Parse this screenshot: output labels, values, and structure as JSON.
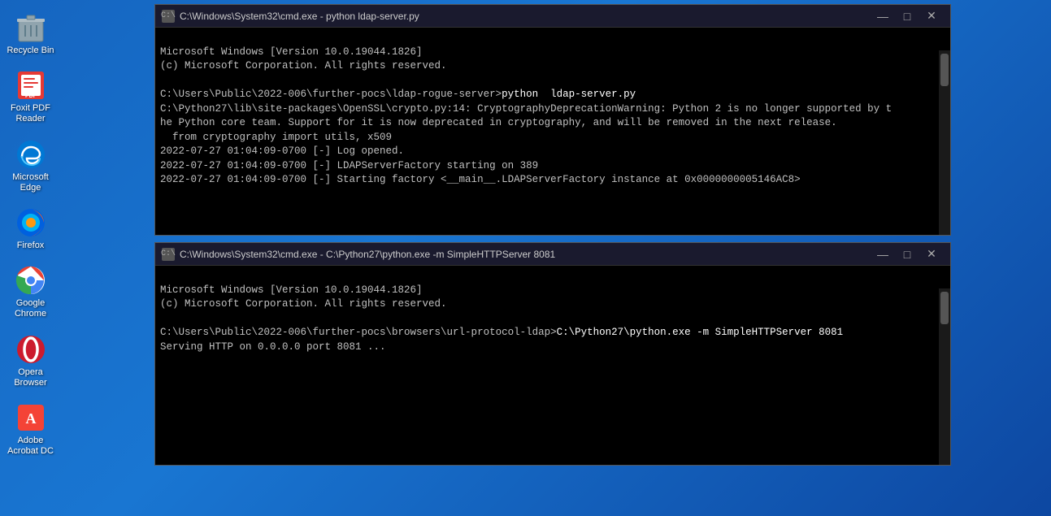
{
  "desktop": {
    "background": "blue-gradient",
    "icons": [
      {
        "id": "recycle-bin",
        "label": "Recycle Bin",
        "icon_type": "recycle"
      },
      {
        "id": "foxit-pdf",
        "label": "Foxit PDF\nReader",
        "icon_type": "foxit"
      },
      {
        "id": "microsoft-edge",
        "label": "Microsoft\nEdge",
        "icon_type": "edge"
      },
      {
        "id": "firefox",
        "label": "Firefox",
        "icon_type": "firefox"
      },
      {
        "id": "google-chrome",
        "label": "Google\nChrome",
        "icon_type": "chrome"
      },
      {
        "id": "opera",
        "label": "Opera\nBrowser",
        "icon_type": "opera"
      },
      {
        "id": "adobe-acrobat",
        "label": "Adobe\nAcrobat DC",
        "icon_type": "adobe"
      }
    ]
  },
  "cmd_window_1": {
    "title": "C:\\Windows\\System32\\cmd.exe - python  ldap-server.py",
    "controls": {
      "minimize": "—",
      "maximize": "□",
      "close": "✕"
    },
    "content": [
      "Microsoft Windows [Version 10.0.19044.1826]",
      "(c) Microsoft Corporation. All rights reserved.",
      "",
      "C:\\Users\\Public\\2022-006\\further-pocs\\ldap-rogue-server>python  ldap-server.py",
      "C:\\Python27\\lib\\site-packages\\OpenSSL\\crypto.py:14: CryptographyDeprecationWarning: Python 2 is no longer supported by t",
      "he Python core team. Support for it is now deprecated in cryptography, and will be removed in the next release.",
      "  from cryptography import utils, x509",
      "2022-07-27 01:04:09-0700 [-] Log opened.",
      "2022-07-27 01:04:09-0700 [-] LDAPServerFactory starting on 389",
      "2022-07-27 01:04:09-0700 [-] Starting factory <__main__.LDAPServerFactory instance at 0x0000000005146AC8>"
    ]
  },
  "cmd_window_2": {
    "title": "C:\\Windows\\System32\\cmd.exe - C:\\Python27\\python.exe -m SimpleHTTPServer 8081",
    "controls": {
      "minimize": "—",
      "maximize": "□",
      "close": "✕"
    },
    "content": [
      "Microsoft Windows [Version 10.0.19044.1826]",
      "(c) Microsoft Corporation. All rights reserved.",
      "",
      "C:\\Users\\Public\\2022-006\\further-pocs\\browsers\\url-protocol-ldap>C:\\Python27\\python.exe -m SimpleHTTPServer 8081",
      "Serving HTTP on 0.0.0.0 port 8081 ..."
    ]
  }
}
